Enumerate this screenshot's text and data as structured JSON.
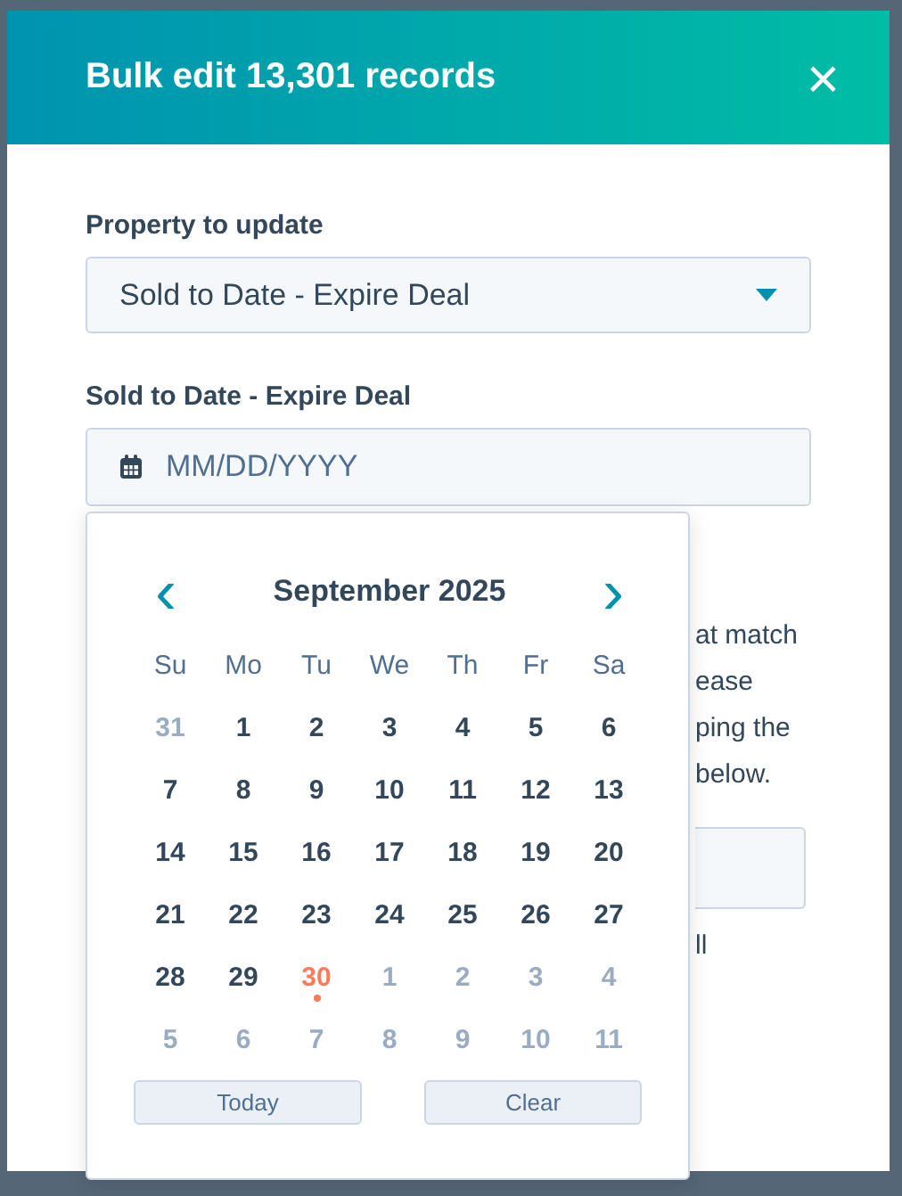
{
  "modal": {
    "title": "Bulk edit 13,301 records",
    "close": "×"
  },
  "property": {
    "label": "Property to update",
    "value": "Sold to Date - Expire Deal"
  },
  "date_field": {
    "label": "Sold to Date - Expire Deal",
    "placeholder": "MM/DD/YYYY"
  },
  "hidden_text": [
    "at match",
    "ease",
    "ping the",
    "below."
  ],
  "hidden_note": "ll",
  "calendar": {
    "month": "September 2025",
    "prev": "‹",
    "next": "›",
    "weekdays": [
      "Su",
      "Mo",
      "Tu",
      "We",
      "Th",
      "Fr",
      "Sa"
    ],
    "weeks": [
      [
        {
          "day": "31",
          "muted": true,
          "today": false
        },
        {
          "day": "1",
          "muted": false,
          "today": false
        },
        {
          "day": "2",
          "muted": false,
          "today": false
        },
        {
          "day": "3",
          "muted": false,
          "today": false
        },
        {
          "day": "4",
          "muted": false,
          "today": false
        },
        {
          "day": "5",
          "muted": false,
          "today": false
        },
        {
          "day": "6",
          "muted": false,
          "today": false
        }
      ],
      [
        {
          "day": "7",
          "muted": false,
          "today": false
        },
        {
          "day": "8",
          "muted": false,
          "today": false
        },
        {
          "day": "9",
          "muted": false,
          "today": false
        },
        {
          "day": "10",
          "muted": false,
          "today": false
        },
        {
          "day": "11",
          "muted": false,
          "today": false
        },
        {
          "day": "12",
          "muted": false,
          "today": false
        },
        {
          "day": "13",
          "muted": false,
          "today": false
        }
      ],
      [
        {
          "day": "14",
          "muted": false,
          "today": false
        },
        {
          "day": "15",
          "muted": false,
          "today": false
        },
        {
          "day": "16",
          "muted": false,
          "today": false
        },
        {
          "day": "17",
          "muted": false,
          "today": false
        },
        {
          "day": "18",
          "muted": false,
          "today": false
        },
        {
          "day": "19",
          "muted": false,
          "today": false
        },
        {
          "day": "20",
          "muted": false,
          "today": false
        }
      ],
      [
        {
          "day": "21",
          "muted": false,
          "today": false
        },
        {
          "day": "22",
          "muted": false,
          "today": false
        },
        {
          "day": "23",
          "muted": false,
          "today": false
        },
        {
          "day": "24",
          "muted": false,
          "today": false
        },
        {
          "day": "25",
          "muted": false,
          "today": false
        },
        {
          "day": "26",
          "muted": false,
          "today": false
        },
        {
          "day": "27",
          "muted": false,
          "today": false
        }
      ],
      [
        {
          "day": "28",
          "muted": false,
          "today": false
        },
        {
          "day": "29",
          "muted": false,
          "today": false
        },
        {
          "day": "30",
          "muted": false,
          "today": true
        },
        {
          "day": "1",
          "muted": true,
          "today": false
        },
        {
          "day": "2",
          "muted": true,
          "today": false
        },
        {
          "day": "3",
          "muted": true,
          "today": false
        },
        {
          "day": "4",
          "muted": true,
          "today": false
        }
      ],
      [
        {
          "day": "5",
          "muted": true,
          "today": false
        },
        {
          "day": "6",
          "muted": true,
          "today": false
        },
        {
          "day": "7",
          "muted": true,
          "today": false
        },
        {
          "day": "8",
          "muted": true,
          "today": false
        },
        {
          "day": "9",
          "muted": true,
          "today": false
        },
        {
          "day": "10",
          "muted": true,
          "today": false
        },
        {
          "day": "11",
          "muted": true,
          "today": false
        }
      ]
    ],
    "buttons": [
      "Today",
      "Clear"
    ]
  }
}
